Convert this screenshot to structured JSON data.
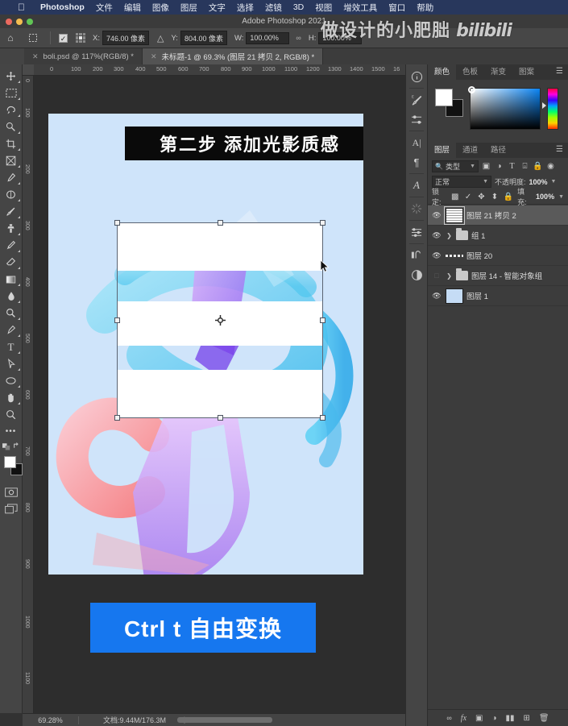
{
  "macmenu": {
    "apple_icon": "apple-icon",
    "items": [
      {
        "label": "Photoshop",
        "bold": true
      },
      {
        "label": "文件"
      },
      {
        "label": "编辑"
      },
      {
        "label": "图像"
      },
      {
        "label": "图层"
      },
      {
        "label": "文字"
      },
      {
        "label": "选择"
      },
      {
        "label": "滤镜"
      },
      {
        "label": "3D"
      },
      {
        "label": "视图"
      },
      {
        "label": "增效工具"
      },
      {
        "label": "窗口"
      },
      {
        "label": "帮助"
      }
    ]
  },
  "titlebar": {
    "title": "Adobe Photoshop 2021"
  },
  "optionsbar": {
    "home_icon": "home-icon",
    "tool_icon": "free-transform-icon",
    "checkbox": "✓",
    "x_label": "X:",
    "x_value": "746.00 像素",
    "delta_icon": "△",
    "y_label": "Y:",
    "y_value": "804.00 像素",
    "w_label": "W:",
    "w_value": "100.00%",
    "link_icon": "∞",
    "h_label": "H:",
    "h_value": "100.00%"
  },
  "watermark": {
    "text": "做设计的小肥朏",
    "logo": "bilibili"
  },
  "tabs": [
    {
      "label": "boli.psd @ 117%(RGB/8) *",
      "active": false
    },
    {
      "label": "未标题-1 @ 69.3% (图层 21 拷贝 2, RGB/8) *",
      "active": true
    }
  ],
  "toolbar": {
    "tools": [
      {
        "name": "move-tool",
        "glyph": "✥"
      },
      {
        "name": "marquee-tool",
        "glyph": "▭"
      },
      {
        "name": "lasso-tool",
        "glyph": "➤"
      },
      {
        "name": "quick-selection-tool",
        "glyph": "✎"
      },
      {
        "name": "crop-tool",
        "glyph": "⌗"
      },
      {
        "name": "frame-tool",
        "glyph": "⊠"
      },
      {
        "name": "eyedropper-tool",
        "glyph": "✒"
      },
      {
        "name": "healing-brush-tool",
        "glyph": "⬭"
      },
      {
        "name": "brush-tool",
        "glyph": "🖌"
      },
      {
        "name": "clone-stamp-tool",
        "glyph": "⚲"
      },
      {
        "name": "history-brush-tool",
        "glyph": "✂"
      },
      {
        "name": "eraser-tool",
        "glyph": "◣"
      },
      {
        "name": "gradient-tool",
        "glyph": "▤"
      },
      {
        "name": "blur-tool",
        "glyph": "💧"
      },
      {
        "name": "dodge-tool",
        "glyph": "🔍"
      },
      {
        "name": "pen-tool",
        "glyph": "✐"
      },
      {
        "name": "type-tool",
        "glyph": "T"
      },
      {
        "name": "path-selection-tool",
        "glyph": "↖"
      },
      {
        "name": "ellipse-shape-tool",
        "glyph": "◯"
      },
      {
        "name": "hand-tool",
        "glyph": "✋"
      },
      {
        "name": "zoom-tool",
        "glyph": "🔎"
      },
      {
        "name": "more-tools",
        "glyph": "•••"
      }
    ],
    "foreground_color": "#ffffff",
    "background_color": "#111111"
  },
  "rulers": {
    "h_ticks": [
      "0",
      "100",
      "200",
      "300",
      "400",
      "500",
      "600",
      "700",
      "800",
      "900",
      "1000",
      "1100",
      "1200",
      "1300",
      "1400",
      "1500",
      "16"
    ],
    "v_ticks": [
      "0",
      "100",
      "200",
      "300",
      "400",
      "500",
      "600",
      "700",
      "800",
      "900",
      "1000",
      "1100"
    ]
  },
  "canvas": {
    "banner_text": "第二步 添加光影质感",
    "button_text": "Ctrl t 自由变换",
    "button_color": "#1677ef",
    "background_color": "#cfe4fa",
    "reference_point": "transform-reference-point"
  },
  "statusbar": {
    "zoom": "69.28%",
    "doc": "文档:9.44M/176.3M",
    "arrow": "〉"
  },
  "rail": {
    "icons": [
      {
        "name": "info-panel-icon",
        "glyph": "ⓘ"
      },
      {
        "name": "brush-panel-icon",
        "glyph": "🖌"
      },
      {
        "name": "brush-settings-icon",
        "glyph": "⚙"
      },
      {
        "name": "character-panel-icon",
        "glyph": "A|"
      },
      {
        "name": "paragraph-panel-icon",
        "glyph": "¶"
      },
      {
        "name": "glyphs-panel-icon",
        "glyph": "𝒜"
      },
      {
        "name": "libraries-panel-icon",
        "glyph": "✳"
      },
      {
        "name": "adjustments-panel-icon",
        "glyph": "⚖"
      },
      {
        "name": "history-panel-icon",
        "glyph": "↻"
      },
      {
        "name": "adjustment-layer-icon",
        "glyph": "◑"
      }
    ]
  },
  "color_panel": {
    "tabs": [
      {
        "label": "颜色",
        "active": true
      },
      {
        "label": "色板",
        "active": false
      },
      {
        "label": "渐变",
        "active": false
      },
      {
        "label": "图案",
        "active": false
      }
    ],
    "foreground": "#ffffff",
    "background": "#111111"
  },
  "layers_panel": {
    "tabs": [
      {
        "label": "图层",
        "active": true
      },
      {
        "label": "通道",
        "active": false
      },
      {
        "label": "路径",
        "active": false
      }
    ],
    "filter_label": "类型",
    "filter_icons": [
      {
        "name": "filter-pixel-icon",
        "glyph": "▣"
      },
      {
        "name": "filter-adjustment-icon",
        "glyph": "◑"
      },
      {
        "name": "filter-type-icon",
        "glyph": "T"
      },
      {
        "name": "filter-shape-icon",
        "glyph": "⬚"
      },
      {
        "name": "filter-smart-object-icon",
        "glyph": "🔒"
      },
      {
        "name": "filter-toggle-icon",
        "glyph": "◉"
      }
    ],
    "blend_mode": "正常",
    "opacity_label": "不透明度:",
    "opacity_value": "100%",
    "lock_label": "锁定:",
    "lock_icons": [
      {
        "name": "lock-transparency-icon",
        "glyph": "▩"
      },
      {
        "name": "lock-image-icon",
        "glyph": "🖌"
      },
      {
        "name": "lock-position-icon",
        "glyph": "✥"
      },
      {
        "name": "lock-nesting-icon",
        "glyph": "⬓"
      },
      {
        "name": "lock-all-icon",
        "glyph": "🔒"
      }
    ],
    "fill_label": "填充:",
    "fill_value": "100%",
    "layers": [
      {
        "name": "图层 21 拷贝 2",
        "visible": true,
        "selected": true,
        "thumb": "stripes",
        "group": false
      },
      {
        "name": "组 1",
        "visible": true,
        "selected": false,
        "thumb": "folder",
        "group": true
      },
      {
        "name": "图层 20",
        "visible": true,
        "selected": false,
        "thumb": "dash",
        "group": false
      },
      {
        "name": "图层 14 - 智能对象组",
        "visible": false,
        "selected": false,
        "thumb": "folder",
        "group": true
      },
      {
        "name": "图层 1",
        "visible": true,
        "selected": false,
        "thumb": "blue",
        "group": false
      }
    ],
    "footer_icons": [
      {
        "name": "link-layers-icon",
        "glyph": "🔗"
      },
      {
        "name": "layer-style-icon",
        "glyph": "fx"
      },
      {
        "name": "layer-mask-icon",
        "glyph": "▣"
      },
      {
        "name": "adjustment-layer-icon",
        "glyph": "◑"
      },
      {
        "name": "new-group-icon",
        "glyph": "📁"
      },
      {
        "name": "new-layer-icon",
        "glyph": "⊞"
      },
      {
        "name": "delete-layer-icon",
        "glyph": "🗑"
      }
    ]
  }
}
